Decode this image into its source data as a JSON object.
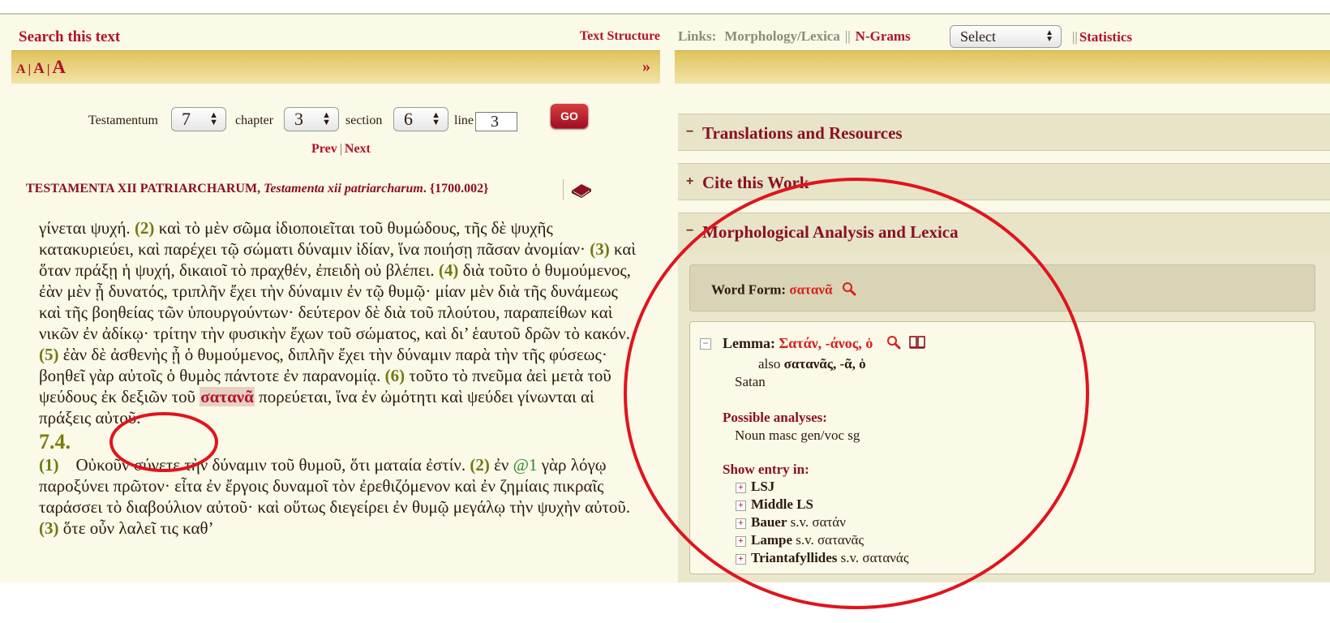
{
  "left": {
    "search_link": "Search this text",
    "text_structure": "Text Structure",
    "font_sizes": [
      "A",
      "A",
      "A"
    ],
    "font_sep": "|",
    "expand": "»",
    "nav": {
      "testamentum_label": "Testamentum",
      "testamentum_value": "7",
      "chapter_label": "chapter",
      "chapter_value": "3",
      "section_label": "section",
      "section_value": "6",
      "line_label": "line",
      "line_value": "3",
      "go": "GO"
    },
    "prev": "Prev",
    "next": "Next",
    "prevnext_sep": "|",
    "work": {
      "author": "TESTAMENTA XII PATRIARCHARUM",
      "comma": ",",
      "title": "Testamenta xii patriarcharum",
      "id": ". {1700.002}"
    },
    "passage": {
      "t1": "γίνεται ψυχή. ",
      "n2": "(2)",
      "t2": " καὶ τὸ μὲν σῶμα ἰδιοποιεῖται τοῦ θυμώδους, τῆς δὲ ψυχῆς κατακυριεύει, καὶ παρέχει τῷ σώματι δύναμιν ἰδίαν, ἵνα ποιήσῃ πᾶσαν ἀνομίαν· ",
      "n3": "(3)",
      "t3": " καὶ ὅταν πράξῃ ἡ ψυχή, δικαιοῖ τὸ πραχθέν, ἐπειδὴ οὐ βλέπει. ",
      "n4": "(4)",
      "t4": " διὰ τοῦτο ὁ θυμούμενος, ἐὰν μὲν ᾖ δυνατός, τριπλῆν ἔχει τὴν δύναμιν ἐν τῷ θυμῷ· μίαν μὲν διὰ τῆς δυνάμεως καὶ τῆς βοηθείας τῶν ὑπουργούντων· δεύτερον δὲ διὰ τοῦ πλούτου, παραπείθων καὶ νικῶν ἐν ἀδίκῳ· τρίτην τὴν φυσικὴν ἔχων τοῦ σώματος, καὶ δι’ ἑαυτοῦ δρῶν τὸ κακόν. ",
      "n5": "(5)",
      "t5": " ἐὰν δὲ ἀσθενὴς ᾖ ὁ θυμούμενος, διπλῆν ἔχει τὴν δύναμιν παρὰ τὴν τῆς φύσεως· βοηθεῖ γὰρ αὐτοῖς ὁ θυμὸς πάντοτε ἐν παρανομίᾳ. ",
      "n6": "(6)",
      "t6": " τοῦτο τὸ πνεῦμα ἀεὶ μετὰ τοῦ ψεύδους ἐκ δεξιῶν τοῦ ",
      "highlight": "σατανᾶ",
      "t7": " πορεύεται, ἵνα ἐν ὠμότητι καὶ ψεύδει γίνωνται αἱ πράξεις αὐτοῦ.",
      "section_heading": "7.4.",
      "n1b": "(1)",
      "t8": "    Οὐκοῦν σύνετε τὴν δύναμιν τοῦ θυμοῦ, ὅτι ματαία ἐστίν. ",
      "n2b": "(2)",
      "t9": " ἐν ",
      "at": "@1",
      "t10": " γὰρ λόγῳ παροξύνει πρῶτον· εἶτα ἐν ἔργοις δυναμοῖ τὸν ἐρεθιζόμενον καὶ ἐν ζημίαις πικραῖς ταράσσει τὸ διαβούλιον αὐτοῦ· καὶ οὕτως διεγείρει ἐν θυμῷ μεγάλῳ τὴν ψυχὴν αὐτοῦ. ",
      "n3b": "(3)",
      "t11": " ὅτε οὖν λαλεῖ τις καθ’"
    }
  },
  "right": {
    "links_label": "Links:",
    "morph_link": "Morphology/Lexica",
    "sep": "||",
    "ngrams": "N-Grams",
    "select_value": "Select",
    "statistics": "Statistics",
    "sections": [
      {
        "toggle": "−",
        "title": "Translations and Resources"
      },
      {
        "toggle": "+",
        "title": "Cite this Work"
      },
      {
        "toggle": "−",
        "title": "Morphological Analysis and Lexica"
      }
    ],
    "word_form_label": "Word Form: ",
    "word_form_value": "σατανᾶ",
    "lemma_label": "Lemma: ",
    "lemma_value": "Σατάν, -άνος, ὁ",
    "also_label": "also ",
    "also_value": "σατανᾶς, -ᾶ, ὁ",
    "gloss": "Satan",
    "possible_label": "Possible analyses:",
    "possible_value": "Noun masc gen/voc sg",
    "show_label": "Show entry in:",
    "entries": [
      {
        "name": "LSJ",
        "sv": ""
      },
      {
        "name": "Middle LS",
        "sv": ""
      },
      {
        "name": "Bauer",
        "sv": " s.v. σατάν"
      },
      {
        "name": "Lampe",
        "sv": " s.v. σατανᾶς"
      },
      {
        "name": "Triantafyllides",
        "sv": " s.v. σατανάς"
      }
    ]
  },
  "colors": {
    "link_red": "#b0132b",
    "annotation_red": "#e0141e",
    "gold": "#dfc35c",
    "panel_bg": "#fbf9e7"
  }
}
